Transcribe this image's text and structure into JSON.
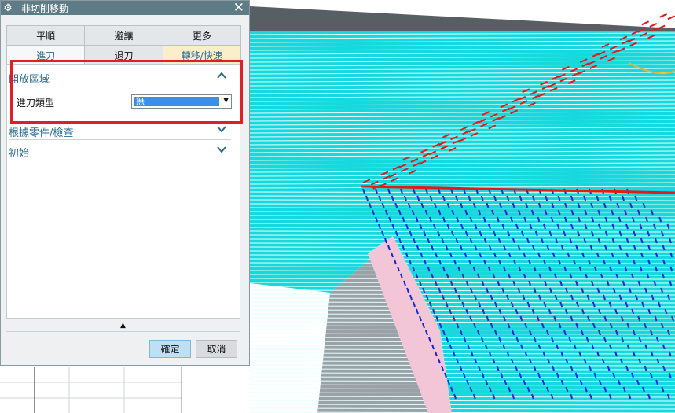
{
  "dialog": {
    "title": "非切削移動",
    "tabs_row1": [
      "平順",
      "避讓",
      "更多"
    ],
    "tabs_row2": [
      "進刀",
      "退刀",
      "轉移/快速"
    ],
    "groups": {
      "open_area": "開放區域",
      "by_part_check": "根據零件/檢查",
      "initial": "初始"
    },
    "entry_type_label": "進刀類型",
    "entry_type_value": "無",
    "ok_label": "確定",
    "cancel_label": "取消"
  },
  "icons": {
    "gear": "⚙",
    "close": "✕",
    "chevron_up": "^",
    "chevron_down": "v",
    "collapse": "▲",
    "dropdown": "▼"
  },
  "colors": {
    "toolpath_cyan": "#00e0e6",
    "toolpath_red": "#e21a1a",
    "toolpath_blue": "#1428d8",
    "part_gray": "#585f64",
    "highlight_red": "#dd2026"
  }
}
